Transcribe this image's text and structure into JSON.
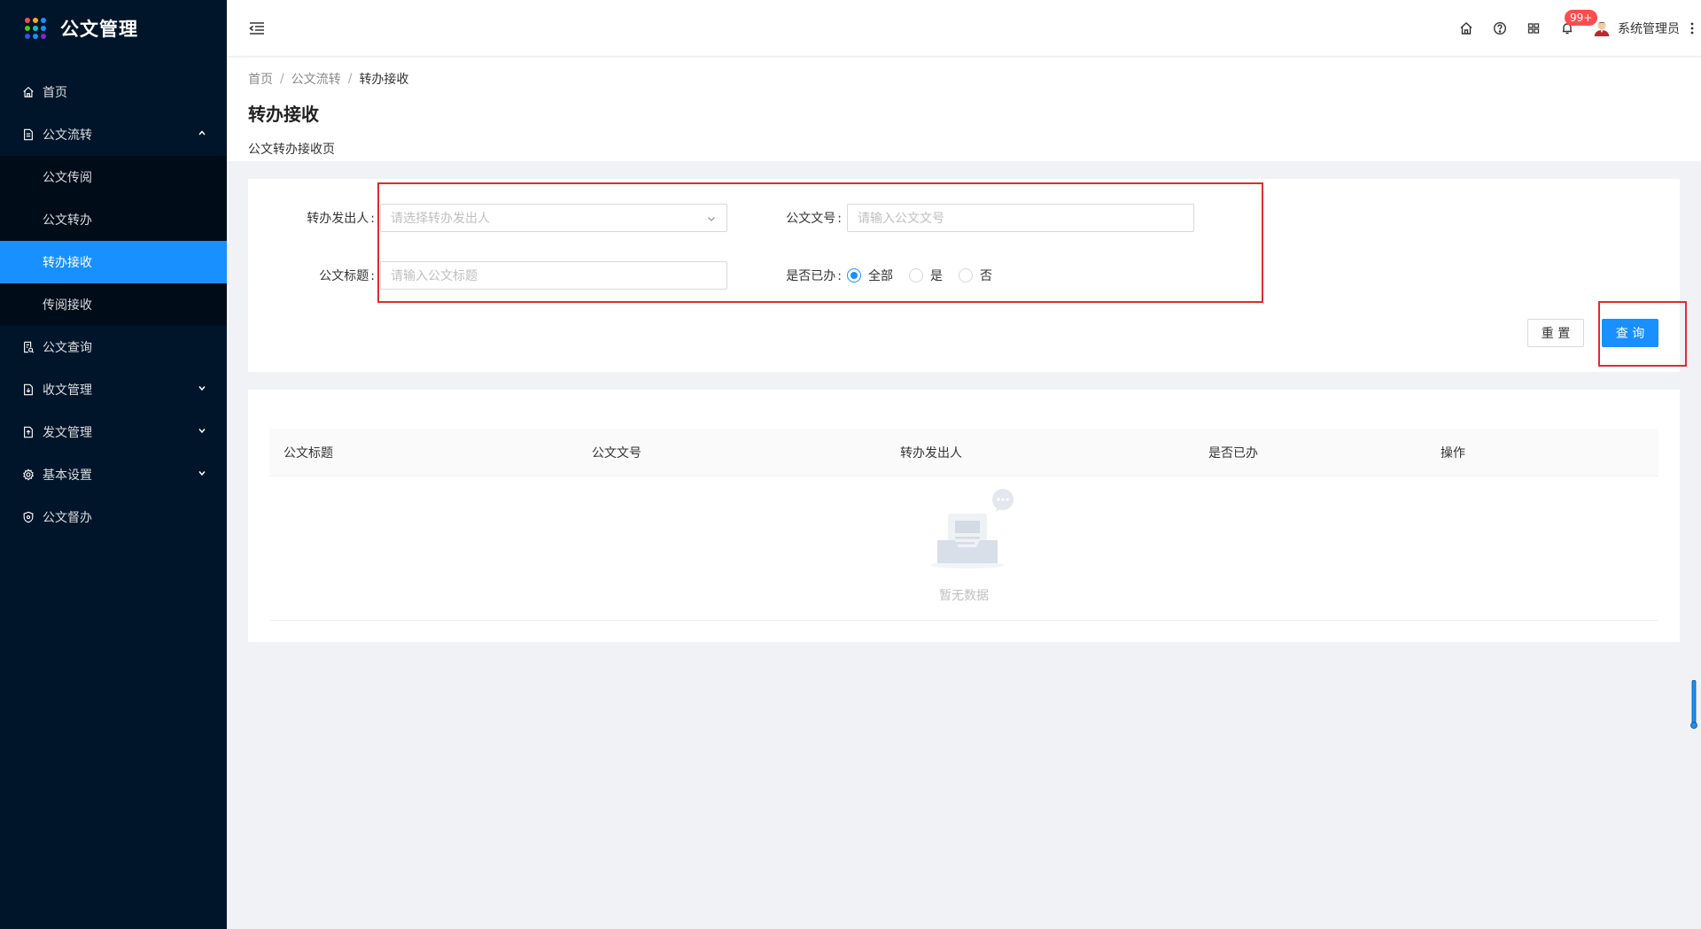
{
  "app": {
    "title": "公文管理",
    "logo_colors": [
      "#ff4d4f",
      "#faad14",
      "#1890ff",
      "#52c41a",
      "#13c2c2",
      "#1890ff",
      "#2f54eb",
      "#1890ff",
      "#722ed1"
    ]
  },
  "sidebar": {
    "items": [
      {
        "label": "首页",
        "icon": "home-icon"
      },
      {
        "label": "公文流转",
        "icon": "document-icon",
        "expanded": true,
        "children": [
          {
            "label": "公文传阅"
          },
          {
            "label": "公文转办"
          },
          {
            "label": "转办接收",
            "active": true
          },
          {
            "label": "传阅接收"
          }
        ]
      },
      {
        "label": "公文查询",
        "icon": "search-doc-icon"
      },
      {
        "label": "收文管理",
        "icon": "inbox-doc-icon"
      },
      {
        "label": "发文管理",
        "icon": "send-doc-icon"
      },
      {
        "label": "基本设置",
        "icon": "gear-icon"
      },
      {
        "label": "公文督办",
        "icon": "shield-icon"
      }
    ]
  },
  "header": {
    "badge": "99+",
    "username": "系统管理员"
  },
  "breadcrumb": [
    "首页",
    "公文流转",
    "转办接收"
  ],
  "page": {
    "title": "转办接收",
    "description": "公文转办接收页"
  },
  "search": {
    "sender_label": "转办发出人",
    "sender_placeholder": "请选择转办发出人",
    "docno_label": "公文文号",
    "docno_placeholder": "请输入公文文号",
    "title_label": "公文标题",
    "title_placeholder": "请输入公文标题",
    "done_label": "是否已办",
    "done_options": [
      "全部",
      "是",
      "否"
    ],
    "done_selected": "全部",
    "reset_label": "重 置",
    "query_label": "查 询"
  },
  "table": {
    "columns": [
      "公文标题",
      "公文文号",
      "转办发出人",
      "是否已办",
      "操作"
    ],
    "rows": [],
    "empty_text": "暂无数据"
  },
  "colors": {
    "sidebar_bg": "#001529",
    "accent": "#1890ff",
    "highlight_box": "#e32b2b"
  }
}
